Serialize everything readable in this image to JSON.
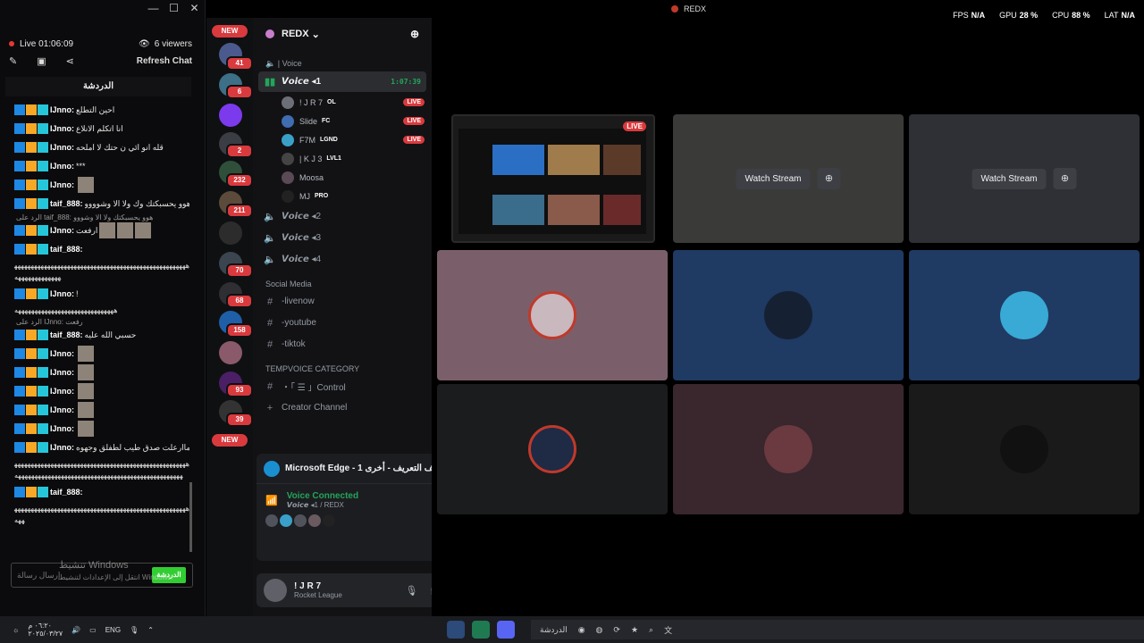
{
  "chat": {
    "live_label": "Live",
    "duration": "01:06:09",
    "viewers": "6 viewers",
    "refresh_label": "Refresh Chat",
    "title": "الدردشة",
    "messages": [
      {
        "user": "IJnno:",
        "text": "احين التطلع"
      },
      {
        "user": "IJnno:",
        "text": "انا اتكلم الانلاع"
      },
      {
        "user": "IJnno:",
        "text": "قله انو ائي ن حتك لا املحه"
      },
      {
        "user": "IJnno:",
        "text": "***"
      },
      {
        "user": "IJnno:",
        "text": ""
      },
      {
        "user": "taif_888:",
        "text": "هوو يحسبكتك وك ولا الا وشوووو"
      }
    ],
    "reply_1": "الرد على taif_888: هوو يحسبكتك ولا الا وشووو",
    "msg_after_reply": {
      "user": "IJnno:",
      "text": "ارفعت"
    },
    "msg_taif_long": {
      "user": "taif_888:",
      "text": ""
    },
    "long_text_1": "ههههههههههههههههههههههههههههههههههههههههههههههههههههههههههههههههههه",
    "msg_ijnno_excl": {
      "user": "IJnno:",
      "text": "!"
    },
    "long_text_2": "ههههههههههههههههههههههههههههههه",
    "reply_2": "الرد على IJnno: رفعت",
    "msg_taif_bless": {
      "user": "taif_888:",
      "text": "حسبي الله عليه"
    },
    "img_msgs": [
      {
        "user": "IJnno:"
      },
      {
        "user": "IJnno:"
      },
      {
        "user": "IJnno:"
      },
      {
        "user": "IJnno:"
      },
      {
        "user": "IJnno:"
      }
    ],
    "msg_ijnno_long": {
      "user": "IJnno:",
      "text": "ماارعلت صدق طيب لطفلق وجهوه"
    },
    "long_text_3": "هههههههههههههههههههههههههههههههههههههههههههههههههههههههههههههههههههههههههههههههههههههههههههههههههههههههه",
    "reply_3": "",
    "msg_taif_final": {
      "user": "taif_888:",
      "text": ""
    },
    "long_text_4": "هههههههههههههههههههههههههههههههههههههههههههههههههههههههه",
    "input_placeholder": "إرسال رسالة",
    "send_label": "الدردشة",
    "watermark_1": "تنشيط Windows",
    "watermark_2": "انتقل إلى الإعدادات لتنشيط Windows."
  },
  "topbar": {
    "app_title": "REDX",
    "stats": [
      {
        "label": "FPS",
        "value": "N/A"
      },
      {
        "label": "GPU",
        "value": "28 %"
      },
      {
        "label": "CPU",
        "value": "88 %"
      },
      {
        "label": "LAT",
        "value": "N/A"
      }
    ]
  },
  "servers": {
    "new_label": "NEW",
    "badges": [
      "41",
      "6",
      "2",
      "232",
      "211",
      "70",
      "68",
      "158",
      "93",
      "39"
    ]
  },
  "guild": {
    "name": "REDX",
    "voice_category": "| Voice",
    "channels_voice": [
      {
        "name": "𝙑𝙤𝙞𝙘𝙚 ◂1",
        "timer": "1:07:39"
      },
      {
        "name": "𝙑𝙤𝙞𝙘𝙚 ◂2"
      },
      {
        "name": "𝙑𝙤𝙞𝙘𝙚 ◂3"
      },
      {
        "name": "𝙑𝙤𝙞𝙘𝙚 ◂4"
      }
    ],
    "members": [
      {
        "name": "! J R 7",
        "tag": "OL",
        "live": "LIVE"
      },
      {
        "name": "Slide",
        "tag": "FC",
        "live": "LIVE"
      },
      {
        "name": "F7M",
        "tag": "LGND",
        "live": "LIVE"
      },
      {
        "name": "| K J 3",
        "tag": "LVL1",
        "live": ""
      },
      {
        "name": "Moosa",
        "tag": "",
        "live": ""
      },
      {
        "name": "MJ",
        "tag": "PRO",
        "live": ""
      }
    ],
    "social_category": "Social Media",
    "social_channels": [
      "-livenow",
      "-youtube",
      "-tiktok"
    ],
    "temp_category": "TEMPVOICE CATEGORY",
    "temp_channels": [
      "・「 ☰ 」Control",
      "Creator Channel"
    ]
  },
  "panel": {
    "window_title": "Microsoft Edge - 1 ملف التعريف - أخرى ...",
    "voice_status": "Voice Connected",
    "voice_sub": "𝙑𝙤𝙞𝙘𝙚 ◂1 / REDX"
  },
  "user": {
    "name": "! J R 7",
    "activity": "Rocket League"
  },
  "stage": {
    "watch_label": "Watch Stream",
    "live_label": "LIVE"
  },
  "taskbar": {
    "time": "٠٦:٢٠ م",
    "date": "٢٠٢٥/٠٣/٢٧",
    "lang": "ENG",
    "search_chip": "الدردشة"
  }
}
